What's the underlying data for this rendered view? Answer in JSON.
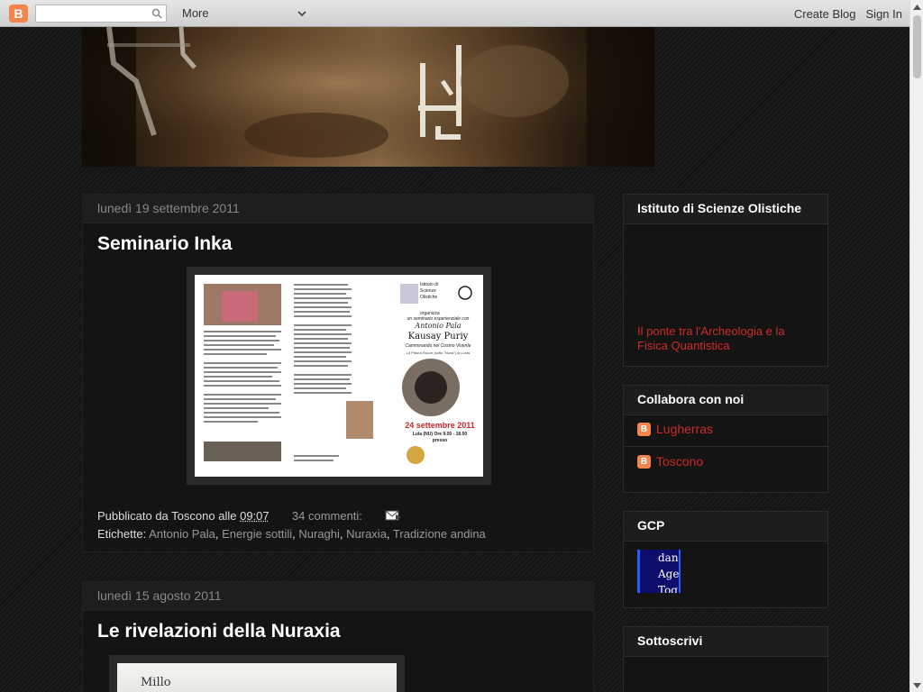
{
  "navbar": {
    "more_label": "More",
    "create_blog": "Create Blog",
    "sign_in": "Sign In",
    "search_value": ""
  },
  "posts": [
    {
      "date": "lunedì 19 settembre 2011",
      "title": "Seminario Inka",
      "published_by_prefix": "Pubblicato da",
      "author": "Toscono",
      "at": "alle",
      "time": "09:07",
      "comments": "34 commenti:",
      "labels_prefix": "Etichette:",
      "labels": [
        "Antonio Pala",
        "Energie sottili",
        "Nuraghi",
        "Nuraxia",
        "Tradizione andina"
      ],
      "flyer": {
        "org": "Istituto di Scienze Olistiche",
        "organizza": "organizza",
        "seminario": "un seminario esperienziale con",
        "speaker": "Antonio Pala",
        "event": "Kausay Puriy",
        "subtitle": "Camminando nel Cosmo Vivente",
        "place": "La Pittura Rocce (sotto \"Nuxa\") di Luras",
        "date": "24 settembre 2011",
        "location_time": "Lula (NU) Ore 9.00 - 18.00",
        "presso": "presso"
      }
    },
    {
      "date": "lunedì 15 agosto 2011",
      "title": "Le rivelazioni della Nuraxia",
      "image_text": "Millo"
    }
  ],
  "sidebar": {
    "istituto": {
      "title": "Istituto di Scienze Olistiche",
      "link": "Il ponte tra l'Archeologia e la Fisica Quantistica"
    },
    "collabora": {
      "title": "Collabora con noi",
      "authors": [
        "Lugherras",
        "Toscono"
      ]
    },
    "gcp": {
      "title": "GCP",
      "lines": [
        "dan",
        "Age",
        "Tog"
      ]
    },
    "sottoscrivi": {
      "title": "Sottoscrivi"
    }
  },
  "colors": {
    "link_red": "#cc2a2a",
    "blogger_orange": "#f3854a",
    "background": "#181818"
  }
}
